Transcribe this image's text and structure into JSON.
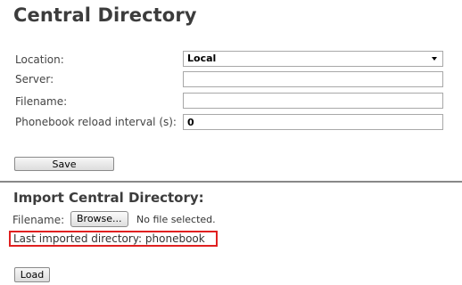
{
  "page": {
    "title": "Central Directory"
  },
  "form": {
    "location_label": "Location:",
    "location_value": "Local",
    "server_label": "Server:",
    "server_value": "",
    "filename_label": "Filename:",
    "filename_value": "",
    "reload_label": "Phonebook reload interval (s):",
    "reload_value": "0",
    "save_label": "Save"
  },
  "import": {
    "title": "Import Central Directory:",
    "filename_label": "Filename:",
    "browse_label": "Browse...",
    "no_file_text": "No file selected.",
    "last_imported_text": "Last imported directory: phonebook",
    "load_label": "Load"
  },
  "colors": {
    "highlight_border": "#e02020",
    "divider": "#888888"
  }
}
